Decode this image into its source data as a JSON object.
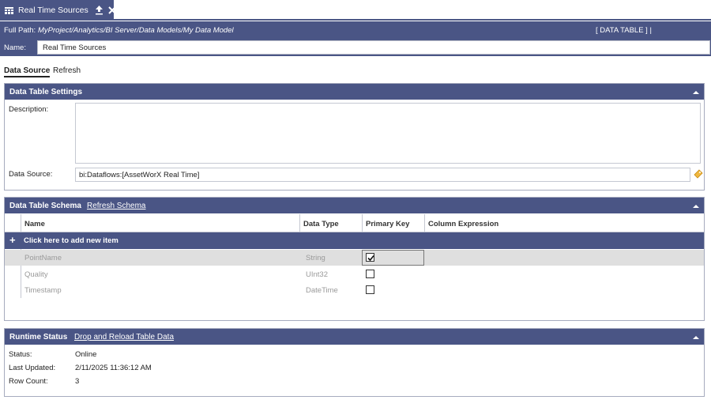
{
  "tab": {
    "label": "Real Time Sources",
    "icon": "table-icon",
    "pin_icon": "pin-icon",
    "close_icon": "close-icon"
  },
  "path": {
    "label": "Full Path:",
    "value": "MyProject/Analytics/BI Server/Data Models/My Data Model",
    "type_tag": "[ DATA TABLE ] |"
  },
  "name": {
    "label": "Name:",
    "value": "Real Time Sources"
  },
  "subtabs": [
    "Data Source",
    "Refresh"
  ],
  "settings": {
    "title": "Data Table Settings",
    "description_label": "Description:",
    "description_value": "",
    "datasource_label": "Data Source:",
    "datasource_value": "bi:Dataflows:[AssetWorX Real Time]",
    "datasource_icon": "tag-icon"
  },
  "schema": {
    "title": "Data Table Schema",
    "refresh_link": "Refresh Schema",
    "columns": [
      "Name",
      "Data Type",
      "Primary Key",
      "Column Expression"
    ],
    "add_label": "Click here to add new item",
    "rows": [
      {
        "name": "PointName",
        "type": "String",
        "primary_key": true,
        "expression": ""
      },
      {
        "name": "Quality",
        "type": "UInt32",
        "primary_key": false,
        "expression": ""
      },
      {
        "name": "Timestamp",
        "type": "DateTime",
        "primary_key": false,
        "expression": ""
      }
    ]
  },
  "runtime": {
    "title": "Runtime Status",
    "reload_link": "Drop and Reload Table Data",
    "status_label": "Status:",
    "status_value": "Online",
    "updated_label": "Last Updated:",
    "updated_value": "2/11/2025 11:36:12 AM",
    "rowcount_label": "Row Count:",
    "rowcount_value": "3"
  },
  "colors": {
    "header": "#4a5585",
    "accent": "#e0a020",
    "selected_row": "#dfdfdf"
  }
}
